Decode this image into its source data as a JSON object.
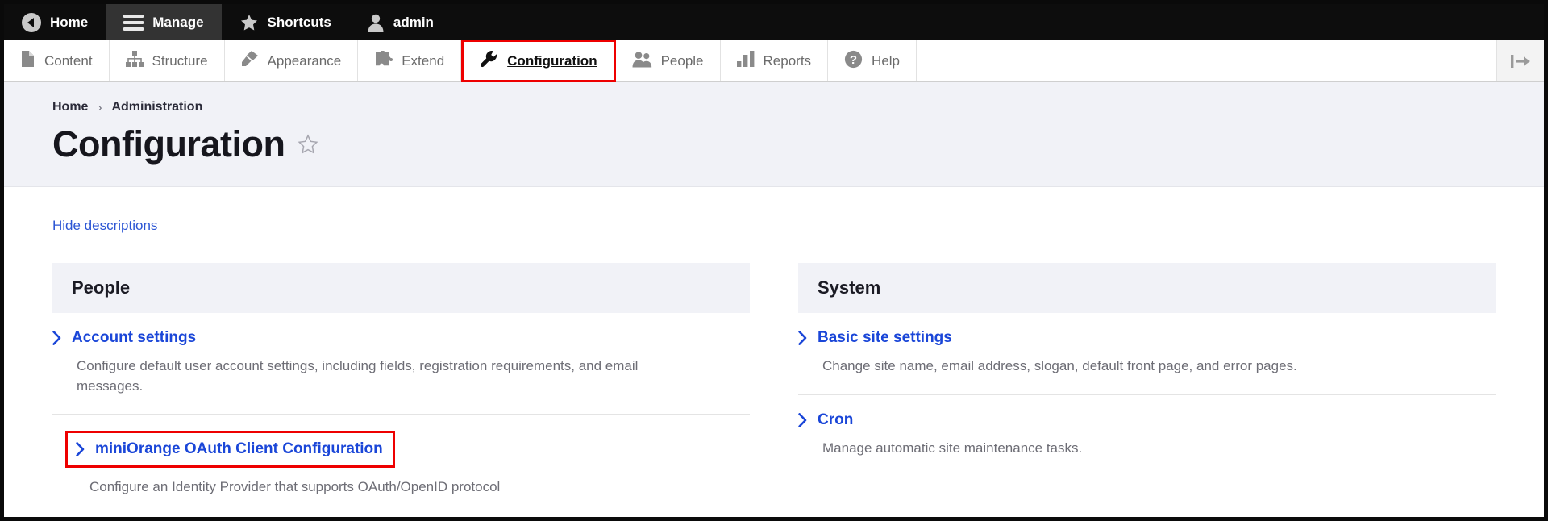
{
  "admin_bar": {
    "items": [
      {
        "label": "Home",
        "icon": "home-back-circle-icon",
        "active": false
      },
      {
        "label": "Manage",
        "icon": "hamburger-menu-icon",
        "active": true
      },
      {
        "label": "Shortcuts",
        "icon": "star-icon",
        "active": false
      },
      {
        "label": "admin",
        "icon": "user-avatar-icon",
        "active": false
      }
    ]
  },
  "toolbar": {
    "items": [
      {
        "label": "Content",
        "icon": "document-icon",
        "highlighted": false
      },
      {
        "label": "Structure",
        "icon": "sitemap-icon",
        "highlighted": false
      },
      {
        "label": "Appearance",
        "icon": "paintbrush-icon",
        "highlighted": false
      },
      {
        "label": "Extend",
        "icon": "puzzle-piece-icon",
        "highlighted": false
      },
      {
        "label": "Configuration",
        "icon": "wrench-icon",
        "highlighted": true
      },
      {
        "label": "People",
        "icon": "people-icon",
        "highlighted": false
      },
      {
        "label": "Reports",
        "icon": "bar-chart-icon",
        "highlighted": false
      },
      {
        "label": "Help",
        "icon": "question-circle-icon",
        "highlighted": false
      }
    ],
    "orientation_toggle_icon": "vertical-orientation-toggle-icon"
  },
  "header": {
    "breadcrumb": [
      "Home",
      "Administration"
    ],
    "separator": "›",
    "title": "Configuration",
    "favorite_icon": "star-outline-icon"
  },
  "content": {
    "hide_descriptions_label": "Hide descriptions",
    "panels": [
      {
        "title": "People",
        "items": [
          {
            "label": "Account settings",
            "description": "Configure default user account settings, including fields, registration requirements, and email messages.",
            "highlighted": false
          },
          {
            "label": "miniOrange OAuth Client Configuration",
            "description": "Configure an Identity Provider that supports OAuth/OpenID protocol",
            "highlighted": true
          }
        ]
      },
      {
        "title": "System",
        "items": [
          {
            "label": "Basic site settings",
            "description": "Change site name, email address, slogan, default front page, and error pages.",
            "highlighted": false
          },
          {
            "label": "Cron",
            "description": "Manage automatic site maintenance tasks.",
            "highlighted": false
          }
        ]
      }
    ]
  },
  "colors": {
    "admin_bar_bg": "#0d0d0d",
    "admin_bar_active_bg": "#333333",
    "link_blue": "#1a46d8",
    "highlight_red": "#ee0000",
    "header_band_bg": "#f1f2f7",
    "panel_head_bg": "#f1f2f7",
    "muted_text": "#6d6d75"
  }
}
